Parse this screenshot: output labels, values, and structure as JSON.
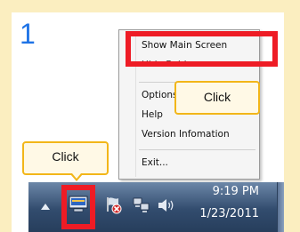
{
  "step": {
    "number": "1"
  },
  "context_menu": {
    "items": [
      {
        "label": "Show Main Screen"
      },
      {
        "label": "Hide Bold"
      },
      {
        "label": "Options"
      },
      {
        "label": "Help"
      },
      {
        "label": "Version Infomation"
      },
      {
        "label": "Exit..."
      }
    ]
  },
  "callouts": {
    "menu_click": "Click",
    "tray_click": "Click"
  },
  "taskbar": {
    "clock": {
      "time": "9:19 PM",
      "date": "1/23/2011"
    },
    "icons": [
      "chevron-up-icon",
      "app-tray-icon",
      "flag-error-icon",
      "network-icon",
      "speaker-icon"
    ]
  },
  "colors": {
    "highlight": "#ee1c25",
    "callout_border": "#f2b619",
    "step_number": "#1e73e6",
    "frame": "#fbeec0"
  }
}
